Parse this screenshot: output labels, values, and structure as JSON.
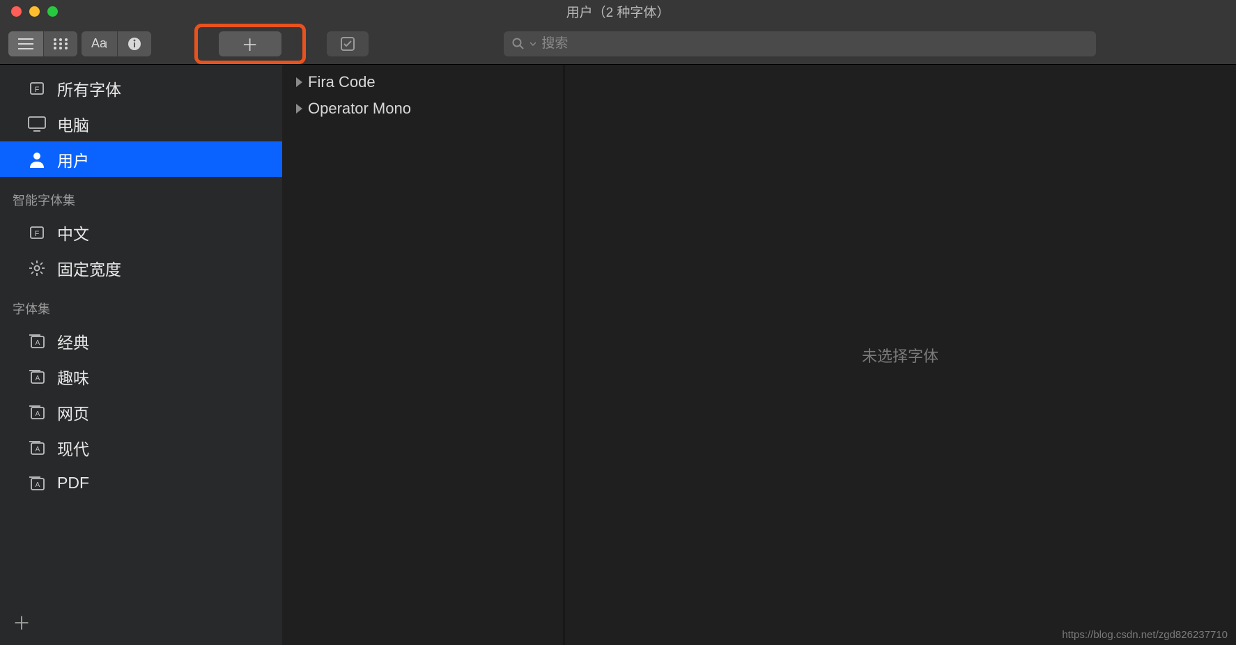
{
  "window": {
    "title": "用户（2 种字体）"
  },
  "toolbar": {
    "search_placeholder": "搜索"
  },
  "sidebar": {
    "sections": [
      {
        "heading": null,
        "items": [
          {
            "id": "all-fonts",
            "label": "所有字体",
            "icon": "font-library-icon",
            "selected": false
          },
          {
            "id": "computer",
            "label": "电脑",
            "icon": "display-icon",
            "selected": false
          },
          {
            "id": "user",
            "label": "用户",
            "icon": "user-icon",
            "selected": true
          }
        ]
      },
      {
        "heading": "智能字体集",
        "items": [
          {
            "id": "chinese",
            "label": "中文",
            "icon": "font-library-icon",
            "selected": false
          },
          {
            "id": "fixed-width",
            "label": "固定宽度",
            "icon": "gear-icon",
            "selected": false
          }
        ]
      },
      {
        "heading": "字体集",
        "items": [
          {
            "id": "classic",
            "label": "经典",
            "icon": "collection-icon",
            "selected": false
          },
          {
            "id": "fun",
            "label": "趣味",
            "icon": "collection-icon",
            "selected": false
          },
          {
            "id": "web",
            "label": "网页",
            "icon": "collection-icon",
            "selected": false
          },
          {
            "id": "modern",
            "label": "现代",
            "icon": "collection-icon",
            "selected": false
          },
          {
            "id": "pdf",
            "label": "PDF",
            "icon": "collection-icon",
            "selected": false
          }
        ]
      }
    ]
  },
  "font_list": [
    {
      "name": "Fira Code",
      "expanded": false
    },
    {
      "name": "Operator Mono",
      "expanded": false
    }
  ],
  "preview": {
    "empty_text": "未选择字体"
  },
  "watermark": "https://blog.csdn.net/zgd826237710"
}
